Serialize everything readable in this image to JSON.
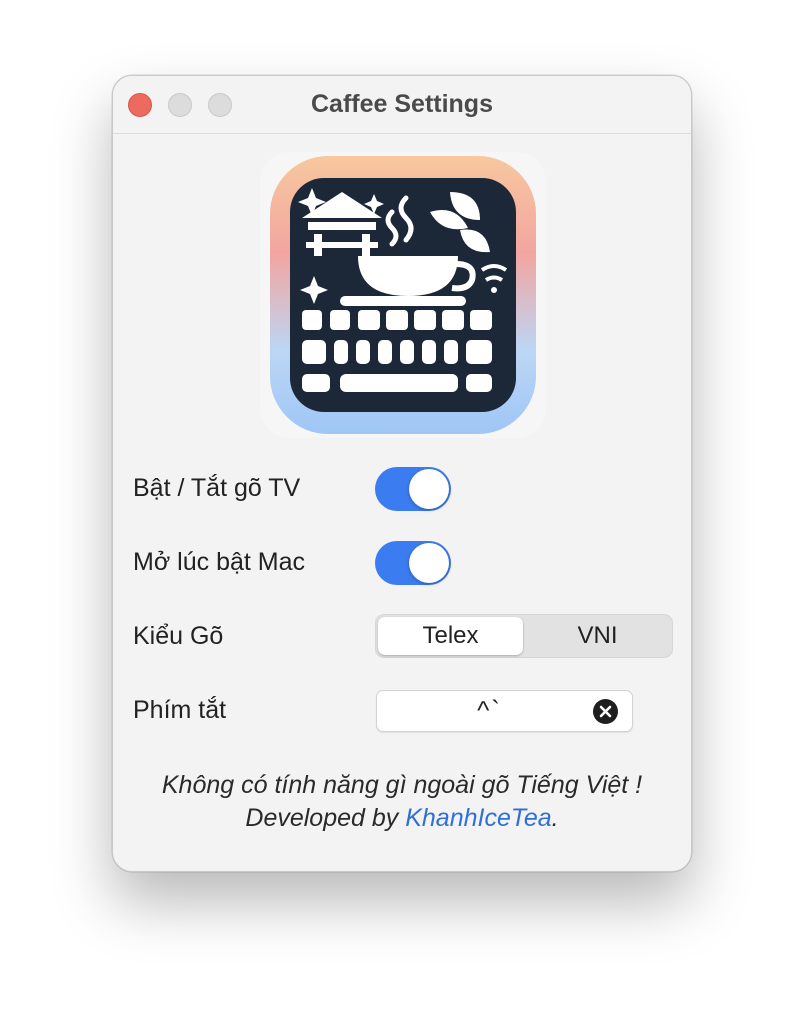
{
  "window": {
    "title": "Caffee Settings"
  },
  "settings": {
    "toggle_vietnamese": {
      "label": "Bật / Tắt gõ TV",
      "on": true
    },
    "launch_at_login": {
      "label": "Mở lúc bật Mac",
      "on": true
    },
    "input_method": {
      "label": "Kiểu Gõ",
      "options": [
        "Telex",
        "VNI"
      ],
      "selected": "Telex"
    },
    "shortcut": {
      "label": "Phím tắt",
      "value": "^`"
    }
  },
  "footer": {
    "line1": "Không có tính năng gì ngoài gõ Tiếng Việt !",
    "line2_prefix": "Developed by ",
    "author_link": "KhanhIceTea",
    "line2_suffix": "."
  },
  "colors": {
    "accent": "#3b7cf0",
    "link": "#2f6fdb",
    "close": "#ed6a5e"
  },
  "icons": [
    "close-icon",
    "app-icon-coffee-keyboard",
    "clear-icon"
  ]
}
